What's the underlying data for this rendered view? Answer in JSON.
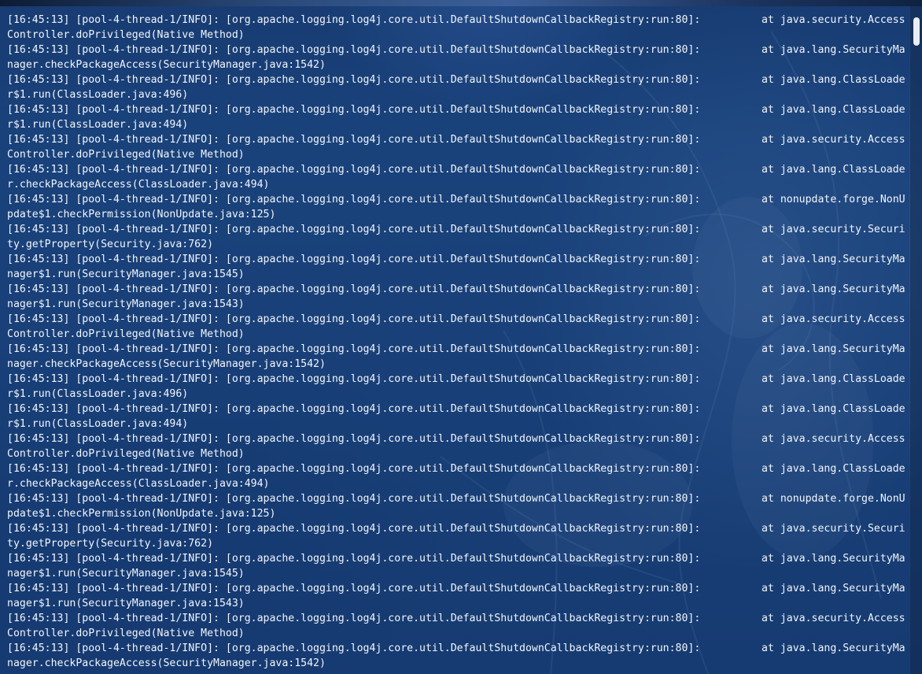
{
  "log": {
    "entries": [
      {
        "prefix": "[16:45:13] [pool-4-thread-1/INFO]: [org.apache.logging.log4j.core.util.DefaultShutdownCallbackRegistry:run:80]:",
        "trace": "at java.security.Access",
        "wrap": "Controller.doPrivileged(Native Method)"
      },
      {
        "prefix": "[16:45:13] [pool-4-thread-1/INFO]: [org.apache.logging.log4j.core.util.DefaultShutdownCallbackRegistry:run:80]:",
        "trace": "at java.lang.SecurityMa",
        "wrap": "nager.checkPackageAccess(SecurityManager.java:1542)"
      },
      {
        "prefix": "[16:45:13] [pool-4-thread-1/INFO]: [org.apache.logging.log4j.core.util.DefaultShutdownCallbackRegistry:run:80]:",
        "trace": "at java.lang.ClassLoade",
        "wrap": "r$1.run(ClassLoader.java:496)"
      },
      {
        "prefix": "[16:45:13] [pool-4-thread-1/INFO]: [org.apache.logging.log4j.core.util.DefaultShutdownCallbackRegistry:run:80]:",
        "trace": "at java.lang.ClassLoade",
        "wrap": "r$1.run(ClassLoader.java:494)"
      },
      {
        "prefix": "[16:45:13] [pool-4-thread-1/INFO]: [org.apache.logging.log4j.core.util.DefaultShutdownCallbackRegistry:run:80]:",
        "trace": "at java.security.Access",
        "wrap": "Controller.doPrivileged(Native Method)"
      },
      {
        "prefix": "[16:45:13] [pool-4-thread-1/INFO]: [org.apache.logging.log4j.core.util.DefaultShutdownCallbackRegistry:run:80]:",
        "trace": "at java.lang.ClassLoade",
        "wrap": "r.checkPackageAccess(ClassLoader.java:494)"
      },
      {
        "prefix": "[16:45:13] [pool-4-thread-1/INFO]: [org.apache.logging.log4j.core.util.DefaultShutdownCallbackRegistry:run:80]:",
        "trace": "at nonupdate.forge.NonU",
        "wrap": "pdate$1.checkPermission(NonUpdate.java:125)"
      },
      {
        "prefix": "[16:45:13] [pool-4-thread-1/INFO]: [org.apache.logging.log4j.core.util.DefaultShutdownCallbackRegistry:run:80]:",
        "trace": "at java.security.Securi",
        "wrap": "ty.getProperty(Security.java:762)"
      },
      {
        "prefix": "[16:45:13] [pool-4-thread-1/INFO]: [org.apache.logging.log4j.core.util.DefaultShutdownCallbackRegistry:run:80]:",
        "trace": "at java.lang.SecurityMa",
        "wrap": "nager$1.run(SecurityManager.java:1545)"
      },
      {
        "prefix": "[16:45:13] [pool-4-thread-1/INFO]: [org.apache.logging.log4j.core.util.DefaultShutdownCallbackRegistry:run:80]:",
        "trace": "at java.lang.SecurityMa",
        "wrap": "nager$1.run(SecurityManager.java:1543)"
      },
      {
        "prefix": "[16:45:13] [pool-4-thread-1/INFO]: [org.apache.logging.log4j.core.util.DefaultShutdownCallbackRegistry:run:80]:",
        "trace": "at java.security.Access",
        "wrap": "Controller.doPrivileged(Native Method)"
      },
      {
        "prefix": "[16:45:13] [pool-4-thread-1/INFO]: [org.apache.logging.log4j.core.util.DefaultShutdownCallbackRegistry:run:80]:",
        "trace": "at java.lang.SecurityMa",
        "wrap": "nager.checkPackageAccess(SecurityManager.java:1542)"
      },
      {
        "prefix": "[16:45:13] [pool-4-thread-1/INFO]: [org.apache.logging.log4j.core.util.DefaultShutdownCallbackRegistry:run:80]:",
        "trace": "at java.lang.ClassLoade",
        "wrap": "r$1.run(ClassLoader.java:496)"
      },
      {
        "prefix": "[16:45:13] [pool-4-thread-1/INFO]: [org.apache.logging.log4j.core.util.DefaultShutdownCallbackRegistry:run:80]:",
        "trace": "at java.lang.ClassLoade",
        "wrap": "r$1.run(ClassLoader.java:494)"
      },
      {
        "prefix": "[16:45:13] [pool-4-thread-1/INFO]: [org.apache.logging.log4j.core.util.DefaultShutdownCallbackRegistry:run:80]:",
        "trace": "at java.security.Access",
        "wrap": "Controller.doPrivileged(Native Method)"
      },
      {
        "prefix": "[16:45:13] [pool-4-thread-1/INFO]: [org.apache.logging.log4j.core.util.DefaultShutdownCallbackRegistry:run:80]:",
        "trace": "at java.lang.ClassLoade",
        "wrap": "r.checkPackageAccess(ClassLoader.java:494)"
      },
      {
        "prefix": "[16:45:13] [pool-4-thread-1/INFO]: [org.apache.logging.log4j.core.util.DefaultShutdownCallbackRegistry:run:80]:",
        "trace": "at nonupdate.forge.NonU",
        "wrap": "pdate$1.checkPermission(NonUpdate.java:125)"
      },
      {
        "prefix": "[16:45:13] [pool-4-thread-1/INFO]: [org.apache.logging.log4j.core.util.DefaultShutdownCallbackRegistry:run:80]:",
        "trace": "at java.security.Securi",
        "wrap": "ty.getProperty(Security.java:762)"
      },
      {
        "prefix": "[16:45:13] [pool-4-thread-1/INFO]: [org.apache.logging.log4j.core.util.DefaultShutdownCallbackRegistry:run:80]:",
        "trace": "at java.lang.SecurityMa",
        "wrap": "nager$1.run(SecurityManager.java:1545)"
      },
      {
        "prefix": "[16:45:13] [pool-4-thread-1/INFO]: [org.apache.logging.log4j.core.util.DefaultShutdownCallbackRegistry:run:80]:",
        "trace": "at java.lang.SecurityMa",
        "wrap": "nager$1.run(SecurityManager.java:1543)"
      },
      {
        "prefix": "[16:45:13] [pool-4-thread-1/INFO]: [org.apache.logging.log4j.core.util.DefaultShutdownCallbackRegistry:run:80]:",
        "trace": "at java.security.Access",
        "wrap": "Controller.doPrivileged(Native Method)"
      },
      {
        "prefix": "[16:45:13] [pool-4-thread-1/INFO]: [org.apache.logging.log4j.core.util.DefaultShutdownCallbackRegistry:run:80]:",
        "trace": "at java.lang.SecurityMa",
        "wrap": "nager.checkPackageAccess(SecurityManager.java:1542)"
      }
    ]
  },
  "theme": {
    "panel_color": "#1f4478",
    "text_color": "#f2f6fb",
    "scroll_thumb_color": "#e8edf3"
  }
}
